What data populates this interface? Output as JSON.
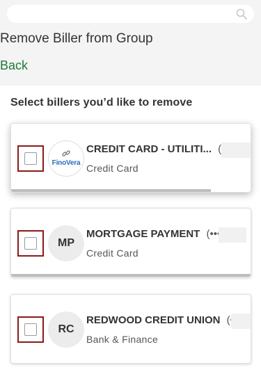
{
  "search": {
    "placeholder": ""
  },
  "page": {
    "title": "Remove Biller from Group",
    "back_label": "Back",
    "instruction": "Select billers you’d like to remove"
  },
  "billers": [
    {
      "name": "CREDIT CARD - UTILITI...",
      "masked": "(••",
      "category": "Credit Card",
      "avatar_text": "",
      "logo_text": "FinoVera",
      "checked": false
    },
    {
      "name": "MORTGAGE PAYMENT",
      "masked": "(•••",
      "category": "Credit Card",
      "avatar_text": "MP",
      "checked": false
    },
    {
      "name": "REDWOOD CREDIT UNION",
      "masked": "(••",
      "category": "Bank & Finance",
      "avatar_text": "RC",
      "checked": false
    }
  ],
  "colors": {
    "back_link": "#1f7a3a",
    "checkbox_highlight": "#8b1a1a",
    "logo_blue": "#2a6cc0"
  },
  "icons": [
    "search-icon",
    "link-icon"
  ]
}
